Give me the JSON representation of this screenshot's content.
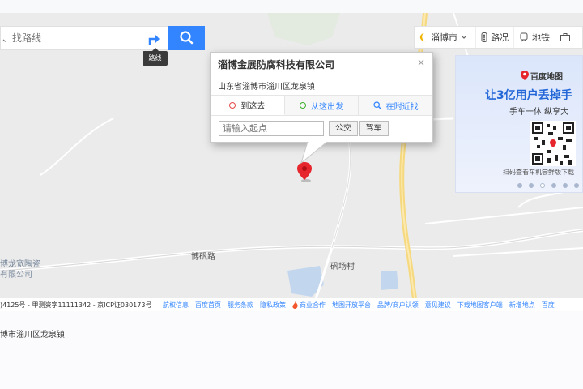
{
  "search": {
    "placeholder": "、找路线",
    "route_tooltip": "路线"
  },
  "toolbar": {
    "city": "淄博市",
    "traffic": "路况",
    "subway": "地铁"
  },
  "map": {
    "road_bofan": "博矾路",
    "village_fanchang": "矾场村",
    "company_label_line1": "博龙宽陶瓷",
    "company_label_line2": "有限公司"
  },
  "info_window": {
    "title": "淄博金展防腐科技有限公司",
    "close": "×",
    "address": "山东省淄博市淄川区龙泉镇",
    "tabs": [
      {
        "label": "到这去",
        "dot_color": "#e64a4a"
      },
      {
        "label": "从这出发",
        "dot_color": "#3fae2a"
      },
      {
        "label": "在附近找",
        "dot_color": "#3385ff"
      }
    ],
    "start_placeholder": "请输入起点",
    "bus_button": "公交",
    "drive_button": "驾车"
  },
  "ad": {
    "brand": "百度地图",
    "headline": "让3亿用户丢掉手",
    "subline": "手车一体 纵享大",
    "caption": "扫码查看车机尝鲜版下载",
    "active_dot": 2
  },
  "footer": {
    "license": ")4125号 - 甲测资字11111342 - 京ICP证030173号",
    "links": [
      "航权信息",
      "百度首页",
      "服务条款",
      "隐私政策",
      "商业合作",
      "地图开放平台",
      "品牌/商户认领",
      "意见建议",
      "下载地图客户端",
      "新增地点",
      "百度"
    ]
  },
  "location": "博市淄川区龙泉镇",
  "colors": {
    "accent": "#3385ff",
    "marker": "#e6262c"
  }
}
